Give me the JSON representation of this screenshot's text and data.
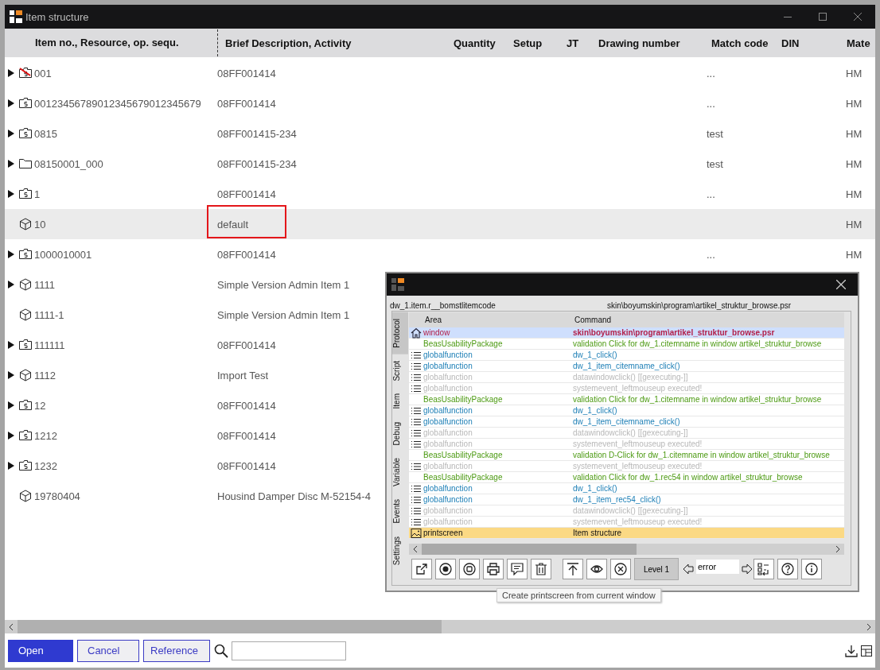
{
  "window": {
    "title": "Item structure"
  },
  "table": {
    "columns": [
      "Item no., Resource, op. sequ.",
      "Brief Description, Activity",
      "Quantity",
      "Setup",
      "JT",
      "Drawing number",
      "Match code",
      "DIN",
      "Mate"
    ],
    "rows": [
      {
        "expandable": true,
        "kind": "stamp-struck",
        "item": "001",
        "description": "08FF001414",
        "match_code": "...",
        "material": "HM",
        "selected": false,
        "marked": false
      },
      {
        "expandable": true,
        "kind": "stamp",
        "item": "00123456789012345679012345679",
        "description": "08FF001414",
        "match_code": "...",
        "material": "HM",
        "selected": false,
        "marked": false
      },
      {
        "expandable": true,
        "kind": "stamp",
        "item": "0815",
        "description": "08FF001415-234",
        "match_code": "test",
        "material": "HM",
        "selected": false,
        "marked": false
      },
      {
        "expandable": true,
        "kind": "folder",
        "item": "08150001_000",
        "description": "08FF001415-234",
        "match_code": "test",
        "material": "HM",
        "selected": false,
        "marked": false
      },
      {
        "expandable": true,
        "kind": "stamp",
        "item": "1",
        "description": "08FF001414",
        "match_code": "...",
        "material": "HM",
        "selected": false,
        "marked": false
      },
      {
        "expandable": false,
        "kind": "cube",
        "item": "10",
        "description": "default",
        "material": "HM",
        "selected": true,
        "marked": true
      },
      {
        "expandable": true,
        "kind": "stamp",
        "item": "1000010001",
        "description": "08FF001414",
        "match_code": "...",
        "material": "HM",
        "selected": false,
        "marked": false
      },
      {
        "expandable": true,
        "kind": "cube",
        "item": "1111",
        "description": "Simple Version Admin Item 1",
        "selected": false,
        "marked": false
      },
      {
        "expandable": false,
        "kind": "cube",
        "item": "1111-1",
        "description": "Simple Version Admin Item 1",
        "selected": false,
        "marked": false
      },
      {
        "expandable": true,
        "kind": "stamp",
        "item": "111111",
        "description": "08FF001414",
        "selected": false,
        "marked": false
      },
      {
        "expandable": true,
        "kind": "cube",
        "item": "1112",
        "description": "Import Test",
        "selected": false,
        "marked": false
      },
      {
        "expandable": true,
        "kind": "stamp",
        "item": "12",
        "description": "08FF001414",
        "selected": false,
        "marked": false
      },
      {
        "expandable": true,
        "kind": "stamp",
        "item": "1212",
        "description": "08FF001414",
        "selected": false,
        "marked": false
      },
      {
        "expandable": true,
        "kind": "stamp",
        "item": "1232",
        "description": "08FF001414",
        "selected": false,
        "marked": false
      },
      {
        "expandable": false,
        "kind": "cube",
        "item": "19780404",
        "description": "Housind Damper Disc M-52154-4",
        "selected": false,
        "marked": false
      }
    ]
  },
  "footer": {
    "buttons": [
      {
        "label": "Open",
        "kind": "primary"
      },
      {
        "label": "Cancel",
        "kind": "secondary"
      },
      {
        "label": "Reference",
        "kind": "secondary"
      }
    ]
  },
  "debug_window": {
    "object": "dw_1.item.r__bomstlitemcode",
    "path": "skin\\boyumskin\\program\\artikel_struktur_browse.psr",
    "tabs": [
      {
        "label": "Protocol",
        "selected": true
      },
      {
        "label": "Script",
        "selected": false
      },
      {
        "label": "Item",
        "selected": false
      },
      {
        "label": "Debug",
        "selected": false
      },
      {
        "label": "Variable",
        "selected": false
      },
      {
        "label": "Events",
        "selected": false
      },
      {
        "label": "Settings",
        "selected": false
      }
    ],
    "log": {
      "columns": [
        "Area",
        "Command"
      ],
      "rows": [
        {
          "kind": "window",
          "area": "window",
          "command": "skin\\boyumskin\\program\\artikel_struktur_browse.psr",
          "selected": true
        },
        {
          "kind": "package",
          "area": "BeasUsabilityPackage",
          "command": "validation Click for dw_1.citemname in window artikel_struktur_browse",
          "selected": false
        },
        {
          "kind": "function",
          "area": "globalfunction",
          "command": "dw_1_click()",
          "selected": false
        },
        {
          "kind": "function",
          "area": "globalfunction",
          "command": "dw_1_item_citemname_click()",
          "selected": false
        },
        {
          "kind": "muted",
          "area": "globalfunction",
          "command": "datawindowclick() [[gexecuting-]]",
          "selected": false
        },
        {
          "kind": "muted",
          "area": "globalfunction",
          "command": "systemevent_leftmouseup executed!",
          "selected": false
        },
        {
          "kind": "package",
          "area": "BeasUsabilityPackage",
          "command": "validation Click for dw_1.citemname in window artikel_struktur_browse",
          "selected": false
        },
        {
          "kind": "function",
          "area": "globalfunction",
          "command": "dw_1_click()",
          "selected": false
        },
        {
          "kind": "function",
          "area": "globalfunction",
          "command": "dw_1_item_citemname_click()",
          "selected": false
        },
        {
          "kind": "muted",
          "area": "globalfunction",
          "command": "datawindowclick() [[gexecuting-]]",
          "selected": false
        },
        {
          "kind": "muted",
          "area": "globalfunction",
          "command": "systemevent_leftmouseup executed!",
          "selected": false
        },
        {
          "kind": "package",
          "area": "BeasUsabilityPackage",
          "command": "validation D-Click for dw_1.citemname in window artikel_struktur_browse",
          "selected": false
        },
        {
          "kind": "muted",
          "area": "globalfunction",
          "command": "systemevent_leftmouseup executed!",
          "selected": false
        },
        {
          "kind": "package",
          "area": "BeasUsabilityPackage",
          "command": "validation Click for dw_1.rec54 in window artikel_struktur_browse",
          "selected": false
        },
        {
          "kind": "function",
          "area": "globalfunction",
          "command": "dw_1_click()",
          "selected": false
        },
        {
          "kind": "function",
          "area": "globalfunction",
          "command": "dw_1_item_rec54_click()",
          "selected": false
        },
        {
          "kind": "muted",
          "area": "globalfunction",
          "command": "datawindowclick() [[gexecuting-]]",
          "selected": false
        },
        {
          "kind": "muted",
          "area": "globalfunction",
          "command": "systemevent_leftmouseup executed!",
          "selected": false
        },
        {
          "kind": "printscreen",
          "area": "printscreen",
          "command": "Item structure",
          "selected": true
        }
      ]
    },
    "tools": [
      {
        "kind": "export"
      },
      {
        "kind": "record"
      },
      {
        "kind": "stop"
      },
      {
        "kind": "print"
      },
      {
        "kind": "comment"
      },
      {
        "kind": "delete"
      },
      {
        "kind": "gap"
      },
      {
        "kind": "upload"
      },
      {
        "kind": "watch"
      },
      {
        "kind": "cancel"
      },
      {
        "kind": "level",
        "label": "Level 1"
      },
      {
        "kind": "prev"
      },
      {
        "kind": "filter",
        "value": "error"
      },
      {
        "kind": "next"
      },
      {
        "kind": "tree"
      },
      {
        "kind": "help"
      },
      {
        "kind": "info"
      }
    ],
    "tooltip": "Create printscreen from current window"
  }
}
